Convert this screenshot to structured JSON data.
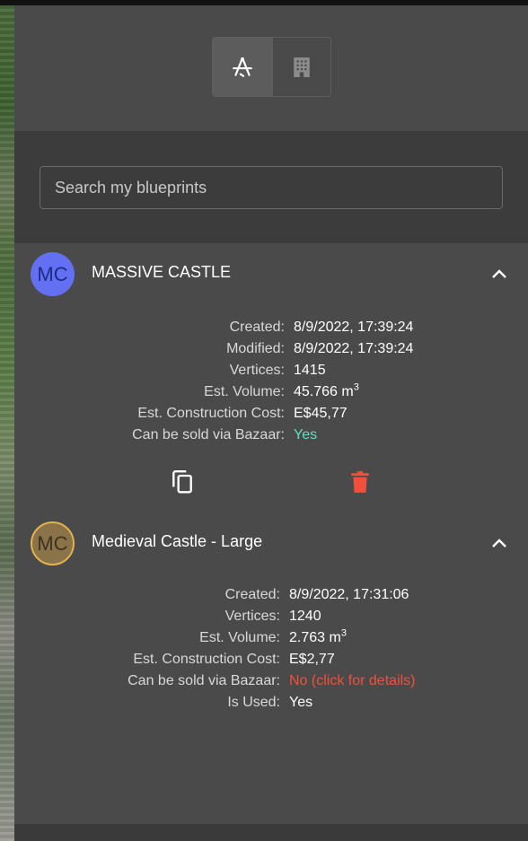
{
  "view_toggle": {
    "options": [
      {
        "icon": "compass-ruler-icon",
        "active": true
      },
      {
        "icon": "building-icon",
        "active": false
      }
    ]
  },
  "search": {
    "placeholder": "Search my blueprints",
    "value": ""
  },
  "blueprints": [
    {
      "initials": "MC",
      "avatar_color": "#6470f2",
      "title": "MASSIVE CASTLE",
      "expanded": true,
      "details": [
        {
          "label": "Created:",
          "value": "8/9/2022, 17:39:24"
        },
        {
          "label": "Modified:",
          "value": "8/9/2022, 17:39:24"
        },
        {
          "label": "Vertices:",
          "value": "1415"
        },
        {
          "label": "Est. Volume:",
          "value": "45.766 m",
          "sup": "3"
        },
        {
          "label": "Est. Construction Cost:",
          "value": "E$45,77"
        },
        {
          "label": "Can be sold via Bazaar:",
          "value": "Yes",
          "status_color": "#5fe0c0"
        }
      ],
      "actions": [
        {
          "icon": "copy-icon",
          "color": "#ffffff"
        },
        {
          "icon": "trash-icon",
          "color": "#f0503c"
        }
      ]
    },
    {
      "initials": "MC",
      "avatar_color": "#8a7348",
      "avatar_border": "#e2b24d",
      "title": "Medieval Castle - Large",
      "expanded": true,
      "details": [
        {
          "label": "Created:",
          "value": "8/9/2022, 17:31:06"
        },
        {
          "label": "Vertices:",
          "value": "1240"
        },
        {
          "label": "Est. Volume:",
          "value": "2.763 m",
          "sup": "3"
        },
        {
          "label": "Est. Construction Cost:",
          "value": "E$2,77"
        },
        {
          "label": "Can be sold via Bazaar:",
          "value": "No (click for details)",
          "status_color": "#f0503c"
        },
        {
          "label": "Is Used:",
          "value": "Yes"
        }
      ]
    }
  ],
  "colors": {
    "panel_bg": "#4a4a4a",
    "search_bg": "#3c3c3c",
    "accent_green": "#5fe0c0",
    "accent_red": "#f0503c"
  }
}
